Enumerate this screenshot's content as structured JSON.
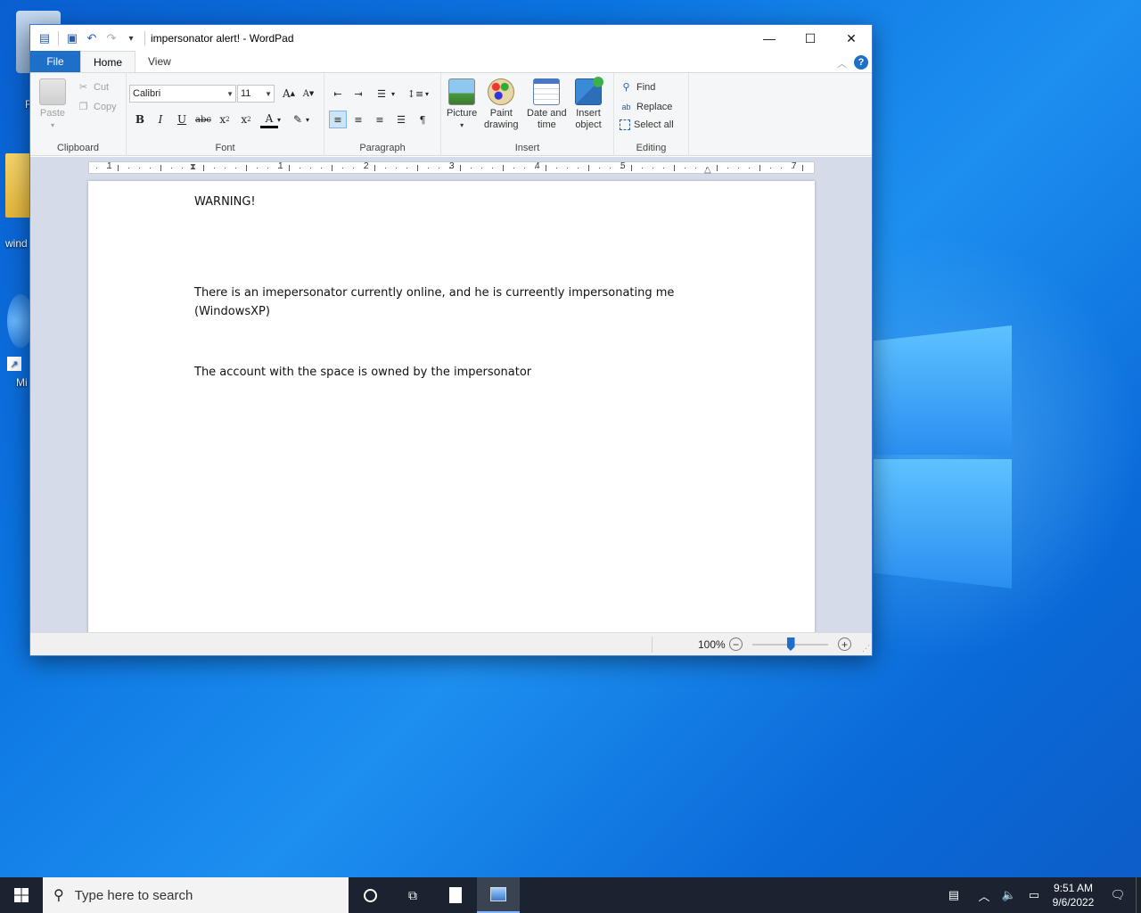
{
  "desktop": {
    "icons": [
      {
        "label": "R"
      },
      {
        "label": "wind"
      },
      {
        "label": "Mi"
      }
    ]
  },
  "window": {
    "title": "impersonator alert! - WordPad",
    "tabs": {
      "file": "File",
      "home": "Home",
      "view": "View"
    },
    "help": "?"
  },
  "ribbon": {
    "clipboard": {
      "label": "Clipboard",
      "paste": "Paste",
      "cut": "Cut",
      "copy": "Copy"
    },
    "font": {
      "label": "Font",
      "family": "Calibri",
      "size": "11"
    },
    "paragraph": {
      "label": "Paragraph"
    },
    "insert": {
      "label": "Insert",
      "picture": "Picture",
      "paint_line1": "Paint",
      "paint_line2": "drawing",
      "datetime_line1": "Date and",
      "datetime_line2": "time",
      "object_line1": "Insert",
      "object_line2": "object"
    },
    "editing": {
      "label": "Editing",
      "find": "Find",
      "replace": "Replace",
      "select_all": "Select all"
    }
  },
  "ruler": {
    "numbers": [
      "1",
      "1",
      "2",
      "3",
      "4",
      "5",
      "7"
    ]
  },
  "document": {
    "line1": "WARNING!",
    "para2_line1": "There is an imepersonator currently online, and he is curreently impersonating me",
    "para2_line2": "(WindowsXP)",
    "para3": "The account with the space is owned by the impersonator"
  },
  "status": {
    "zoom": "100%",
    "zoom_percent": 100
  },
  "taskbar": {
    "search_placeholder": "Type here to search",
    "time": "9:51 AM",
    "date": "9/6/2022"
  }
}
